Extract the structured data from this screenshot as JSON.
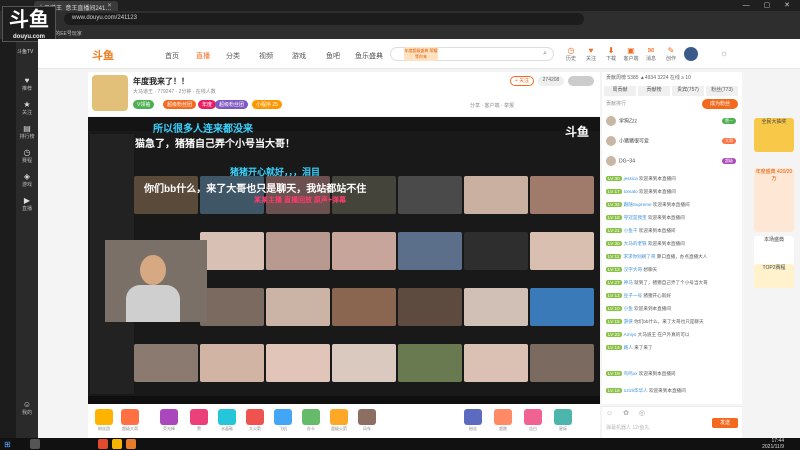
{
  "browser": {
    "tab_title": "大马道王_意王直播间241…",
    "url": "www.douyu.com/241123",
    "bookmark": "11月新的EE号玩家"
  },
  "overlay_logo": {
    "text": "斗鱼",
    "sub": "douyu.com"
  },
  "left_sidebar": {
    "brand": "斗鱼TV",
    "items": [
      "推荐",
      "关注",
      "排行榜",
      "赛程",
      "游戏",
      "直播",
      "我的"
    ]
  },
  "header": {
    "nav": [
      "首页",
      "直播",
      "分类",
      "视频",
      "游戏",
      "鱼吧",
      "鱼乐盛典"
    ],
    "promo": "年度超级盛典 荣耀等你来",
    "search_placeholder": "",
    "icons": [
      {
        "label": "历史",
        "name": "history-icon"
      },
      {
        "label": "关注",
        "name": "follow-icon"
      },
      {
        "label": "下载",
        "name": "download-icon"
      },
      {
        "label": "客户端",
        "name": "client-icon"
      },
      {
        "label": "消息",
        "name": "message-icon"
      },
      {
        "label": "创作",
        "name": "create-icon"
      }
    ]
  },
  "room": {
    "title": "年度我来了！！",
    "meta": "大马道王 · 779247 · 2分钟 · 在线人数",
    "follow": "+ 关注",
    "fans": "274208",
    "pills": [
      "V领袖",
      "超级粉丝团",
      "年度",
      "超级粉丝团",
      "小程序 25"
    ],
    "actions": [
      "分享",
      "客户端",
      "举报"
    ]
  },
  "video": {
    "caption1": "所以很多人连来都没来",
    "caption2": "猫急了，猪猪自己弄个小号当大哥！",
    "caption3": "猪猪开心就好，，，泪目",
    "caption4": "你们bb什么，来了大哥也只是聊天，我站都站不住",
    "caption5": "某某主播 直播回放 原声+弹幕",
    "logo": "斗鱼"
  },
  "gifts": [
    "粉丝团",
    "超级大哥",
    "荧光棒",
    "赞",
    "水晶鞋",
    "大火箭",
    "飞机",
    "办卡",
    "超级火箭",
    "风车",
    "粉丝",
    "超跑",
    "告白",
    "星际"
  ],
  "rank": {
    "head": "贡献周榜  5385  ▲4934  3224  在线  ≥ 10",
    "tabs": [
      "周贡献",
      "贡献榜",
      "贵宾(757)",
      "粉丝(773)"
    ],
    "rows": [
      {
        "name": "学狗Zzz",
        "badge": "赞一"
      },
      {
        "name": "小猪猪很可爱",
        "badge": "大哥"
      },
      {
        "name": "DG~34",
        "badge": "超级"
      }
    ]
  },
  "chat": [
    {
      "lv": "LV 30",
      "name": "jessica",
      "text": "欢迎来到本直播间"
    },
    {
      "lv": "LV 17",
      "name": "tomato",
      "text": "欢迎来到本直播间"
    },
    {
      "lv": "LV 32",
      "name": "跟随Supreme",
      "text": "欢迎来到本直播间"
    },
    {
      "lv": "LV 18",
      "name": "夺冠是我宝",
      "text": "欢迎来到本直播间"
    },
    {
      "lv": "LV 21",
      "name": "小鱼干",
      "text": "欢迎来到本直播间"
    },
    {
      "lv": "LV 30",
      "name": "大马的老铁",
      "text": "欢迎来到本直播间"
    },
    {
      "lv": "LV 11",
      "name": "求求你别刷了哥",
      "text": "算口直播，办点直播大人"
    },
    {
      "lv": "LV 12",
      "name": "汉字大哥",
      "text": "想聊天"
    },
    {
      "lv": "LV 27",
      "name": "神马",
      "text": "就到了，猪猪自己弄了个小号当大哥"
    },
    {
      "lv": "LV 13",
      "name": "豆子一号",
      "text": "猪猪开心就好"
    },
    {
      "lv": "LV 10",
      "name": "小鱼",
      "text": "欢迎来到本直播间"
    },
    {
      "lv": "LV 15",
      "name": "游侠",
      "text": "你们bb什么，来了大哥也只是聊天"
    },
    {
      "lv": "LV 23",
      "name": "Amiyo",
      "text": "大马道王 在户外真的可以"
    },
    {
      "lv": "LV 14",
      "name": "路人",
      "text": "来了来了"
    },
    {
      "lv": "LV 19",
      "name": "鸟鸣xx",
      "text": "欢迎来到本直播间"
    },
    {
      "lv": "LV 16",
      "name": "1219华华人",
      "text": "欢迎来到本直播间"
    }
  ],
  "chat_input": {
    "placeholder": "弹幕机器人 12/鱼丸",
    "send": "发送"
  },
  "ads": [
    "全民大抽奖",
    "年度盛典 420/20万",
    "本场盛典",
    "TOP2赛程"
  ],
  "taskbar": {
    "time": "17:44",
    "date": "2021/11/9"
  }
}
